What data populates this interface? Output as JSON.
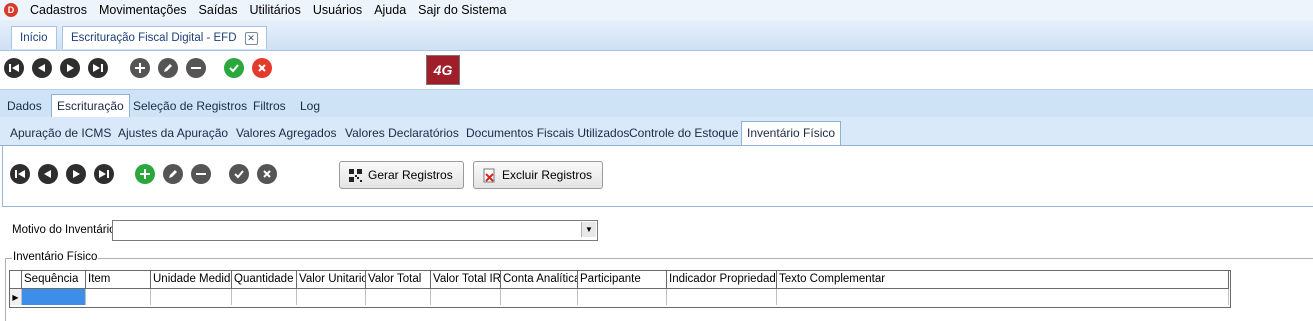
{
  "menu": {
    "items": [
      "Cadastros",
      "Movimentações",
      "Saídas",
      "Utilitários",
      "Usuários",
      "Ajuda",
      "Sajr do Sistema"
    ]
  },
  "doc_tabs": {
    "home": "Início",
    "efd": "Escrituração Fiscal Digital - EFD"
  },
  "tabs_level1": [
    "Dados",
    "Escrituração",
    "Seleção de Registros",
    "Filtros",
    "Log"
  ],
  "tabs_level2": [
    "Apuração de ICMS",
    "Ajustes da Apuração",
    "Valores Agregados",
    "Valores Declaratórios",
    "Documentos Fiscais Utilizados",
    "Controle do Estoque",
    "Inventário Físico"
  ],
  "panel": {
    "generate_label": "Gerar Registros",
    "delete_label": "Excluir Registros"
  },
  "form": {
    "motivo_label": "Motivo do Inventário",
    "motivo_value": ""
  },
  "group": {
    "title": "Inventário Físico"
  },
  "grid": {
    "columns": [
      "Sequência",
      "Item",
      "Unidade Medida",
      "Quantidade",
      "Valor Unitario",
      "Valor Total",
      "Valor Total IR",
      "Conta Analítica",
      "Participante",
      "Indicador Propriedade",
      "Texto Complementar"
    ]
  },
  "logo": {
    "text": "4G"
  },
  "colors": {
    "accent": "#cfe3f7",
    "green": "#2aa83d",
    "red": "#e23a2b"
  }
}
